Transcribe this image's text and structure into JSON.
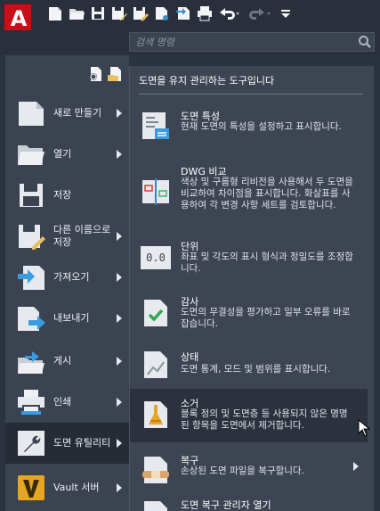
{
  "app": {
    "logo_letter": "A",
    "accent": "#c5101a"
  },
  "quick_access": {
    "icons": [
      "new-icon",
      "open-icon",
      "save-icon",
      "save-as-icon",
      "open-from-web-icon",
      "save-to-web-icon",
      "plot-icon",
      "undo-icon",
      "redo-icon",
      "customize-icon"
    ]
  },
  "search": {
    "placeholder": "검색 명령"
  },
  "left_menu": {
    "items": [
      {
        "label": "새로 만들기",
        "icon": "new-drawing-icon",
        "has_submenu": true
      },
      {
        "label": "열기",
        "icon": "open-folder-icon",
        "has_submenu": true
      },
      {
        "label": "저장",
        "icon": "save-disk-icon",
        "has_submenu": false
      },
      {
        "label": "다른 이름으로 저장",
        "icon": "save-as-disk-icon",
        "has_submenu": true
      },
      {
        "label": "가져오기",
        "icon": "import-icon",
        "has_submenu": true
      },
      {
        "label": "내보내기",
        "icon": "export-icon",
        "has_submenu": true
      },
      {
        "label": "게시",
        "icon": "publish-icon",
        "has_submenu": true
      },
      {
        "label": "인쇄",
        "icon": "print-icon",
        "has_submenu": true
      },
      {
        "label": "도면 유틸리티",
        "icon": "drawing-utilities-icon",
        "has_submenu": true,
        "active": true
      },
      {
        "label": "Vault 서버",
        "icon": "vault-icon",
        "has_submenu": true
      }
    ]
  },
  "utilities_pane": {
    "title": "도면을 유지 관리하는 도구입니다",
    "items": [
      {
        "title": "도면 특성",
        "desc": "현재 도면의 특성을 설정하고 표시합니다.",
        "icon": "drawing-properties-icon"
      },
      {
        "title": "DWG 비교",
        "desc": "색상 및 구름형 리비전을 사용해서 두 도면을 비교하여 차이점을 표시합니다. 화살표를 사용하여 각 변경 사항 세트를 검토합니다.",
        "icon": "dwg-compare-icon"
      },
      {
        "title": "단위",
        "desc": "좌표 및 각도의 표시 형식과 정밀도를 조정합니다.",
        "icon": "units-icon",
        "icon_text": "0.0"
      },
      {
        "title": "감사",
        "desc": "도면의 무결성을 평가하고 일부 오류를 바로잡습니다.",
        "icon": "audit-icon"
      },
      {
        "title": "상태",
        "desc": "도면 통계, 모드 및 범위를 표시합니다.",
        "icon": "status-icon"
      },
      {
        "title": "소거",
        "desc": "블록 정의 및 도면층 등 사용되지 않은 명명된 항목을 도면에서 제거합니다.",
        "icon": "purge-icon",
        "hover": true
      },
      {
        "title": "복구",
        "desc": "손상된 도면 파일을 복구합니다.",
        "icon": "recover-icon",
        "has_submenu": true
      },
      {
        "title": "도면 복구 관리자 열기",
        "desc": "",
        "icon": "recovery-manager-icon"
      }
    ]
  }
}
